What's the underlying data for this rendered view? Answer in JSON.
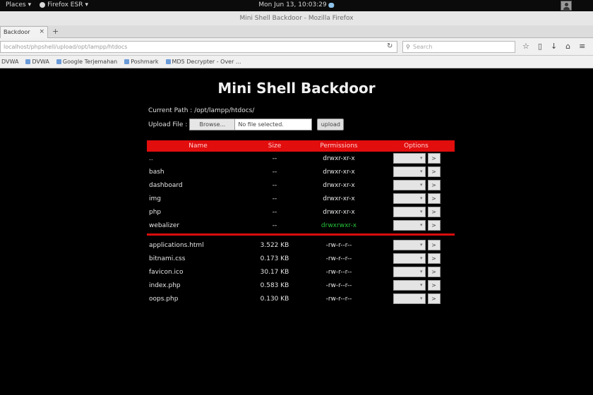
{
  "system_bar": {
    "places": "Places",
    "app": "Firefox ESR",
    "clock": "Mon Jun 13, 10:03:29"
  },
  "window": {
    "title": "Mini Shell Backdoor - Mozilla Firefox"
  },
  "tab": {
    "label": "Backdoor"
  },
  "navbar": {
    "url": "localhost/phpshell/upload/opt/lampp/htdocs",
    "search_placeholder": "Search"
  },
  "bookmarks": [
    "DVWA",
    "DVWA",
    "Google Terjemahan",
    "Poshmark",
    "MD5 Decrypter - Over ..."
  ],
  "page": {
    "title": "Mini Shell Backdoor",
    "current_path": "Current Path : /opt/lampp/htdocs/",
    "upload_label": "Upload File :",
    "browse_label": "Browse...",
    "no_file": "No file selected.",
    "upload_button": "upload",
    "columns": [
      "Name",
      "Size",
      "Permissions",
      "Options"
    ],
    "directories": [
      {
        "name": "..",
        "size": "--",
        "perm": "drwxr-xr-x",
        "writable": false
      },
      {
        "name": "bash",
        "size": "--",
        "perm": "drwxr-xr-x",
        "writable": false
      },
      {
        "name": "dashboard",
        "size": "--",
        "perm": "drwxr-xr-x",
        "writable": false
      },
      {
        "name": "img",
        "size": "--",
        "perm": "drwxr-xr-x",
        "writable": false
      },
      {
        "name": "php",
        "size": "--",
        "perm": "drwxr-xr-x",
        "writable": false
      },
      {
        "name": "webalizer",
        "size": "--",
        "perm": "drwxrwxr-x",
        "writable": true
      }
    ],
    "files": [
      {
        "name": "applications.html",
        "size": "3.522 KB",
        "perm": "-rw-r--r--"
      },
      {
        "name": "bitnami.css",
        "size": "0.173 KB",
        "perm": "-rw-r--r--"
      },
      {
        "name": "favicon.ico",
        "size": "30.17 KB",
        "perm": "-rw-r--r--"
      },
      {
        "name": "index.php",
        "size": "0.583 KB",
        "perm": "-rw-r--r--"
      },
      {
        "name": "oops.php",
        "size": "0.130 KB",
        "perm": "-rw-r--r--"
      }
    ],
    "go_label": ">"
  },
  "colors": {
    "header_red": "#e20d0d",
    "writable_green": "#27c23a"
  }
}
